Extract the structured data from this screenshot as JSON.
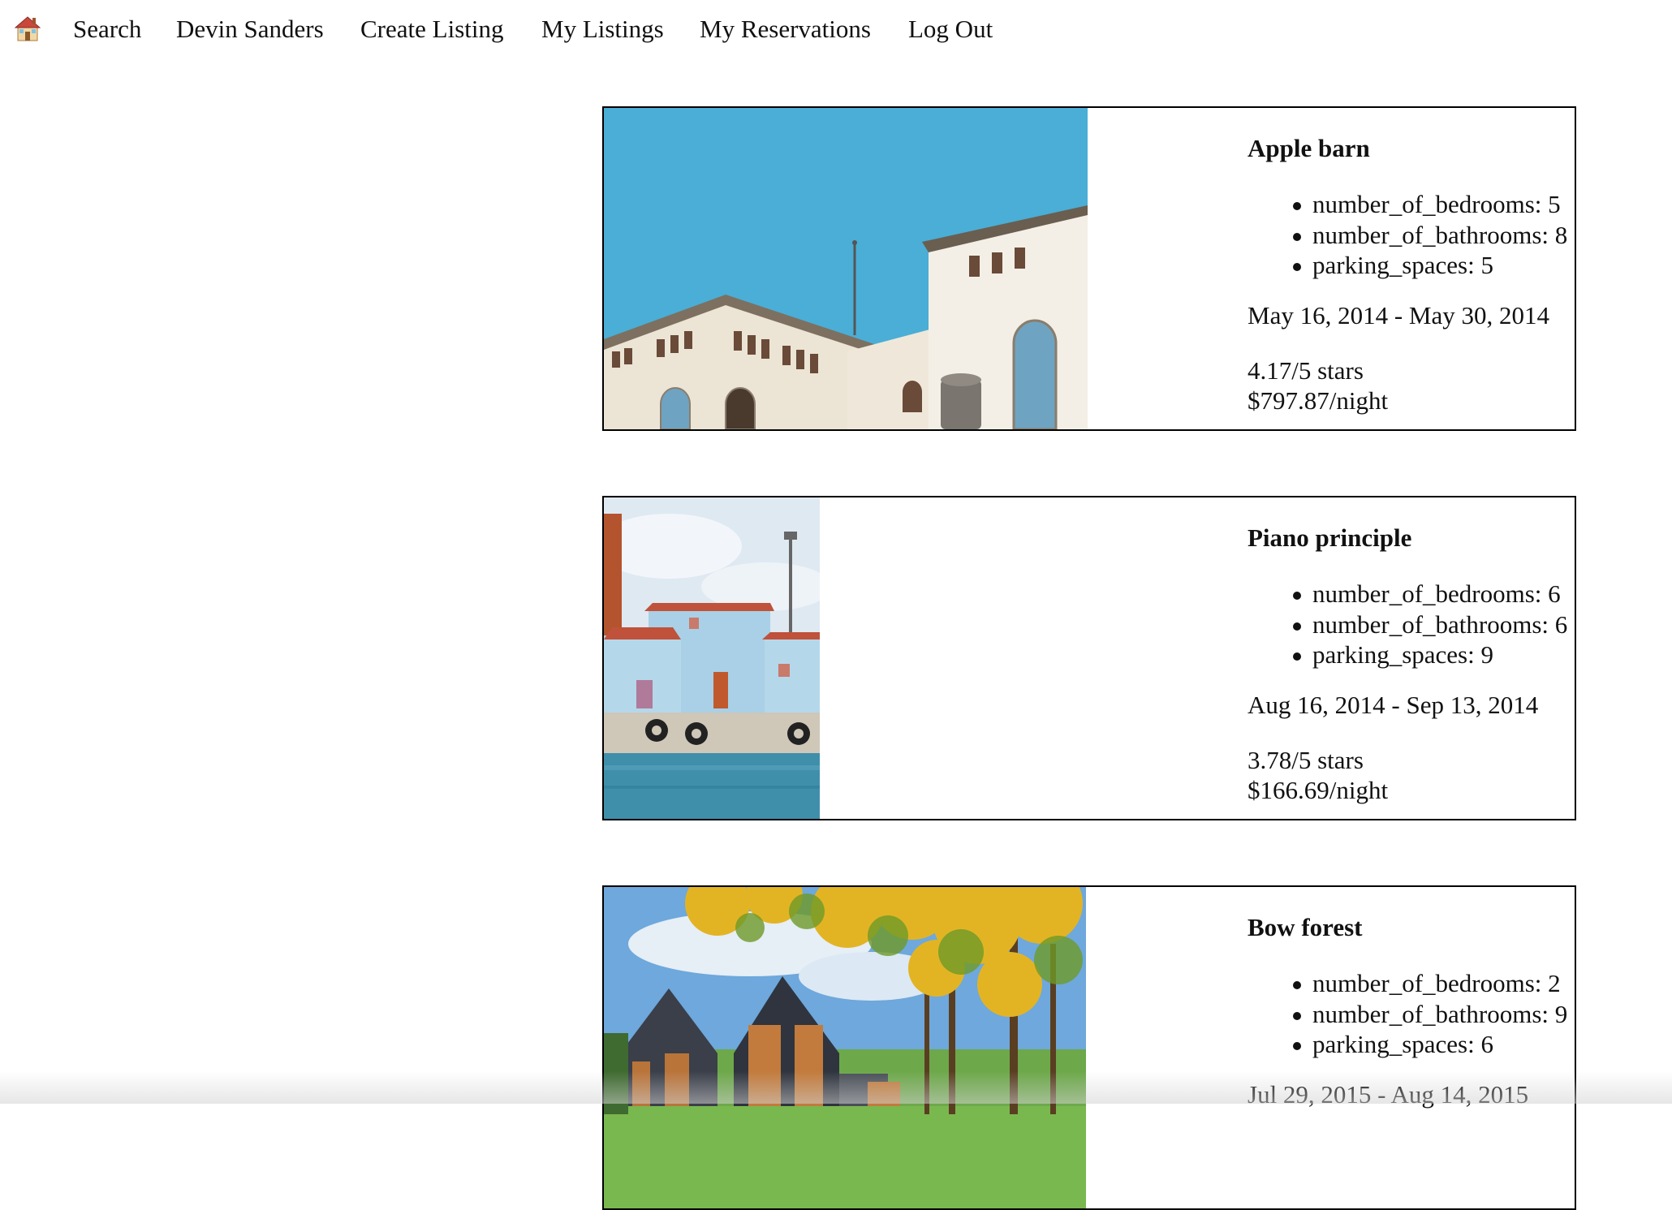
{
  "nav": {
    "home_icon": "house-emoji-icon",
    "items": [
      {
        "label": "Search"
      },
      {
        "label": "Devin Sanders"
      },
      {
        "label": "Create Listing"
      },
      {
        "label": "My Listings"
      },
      {
        "label": "My Reservations"
      },
      {
        "label": "Log Out"
      }
    ]
  },
  "listings": [
    {
      "title": "Apple barn",
      "features": [
        "number_of_bedrooms: 5",
        "number_of_bathrooms: 8",
        "parking_spaces: 5"
      ],
      "dates": "May 16, 2014 - May 30, 2014",
      "rating": "4.17/5 stars",
      "price": "$797.87/night"
    },
    {
      "title": "Piano principle",
      "features": [
        "number_of_bedrooms: 6",
        "number_of_bathrooms: 6",
        "parking_spaces: 9"
      ],
      "dates": "Aug 16, 2014 - Sep 13, 2014",
      "rating": "3.78/5 stars",
      "price": "$166.69/night"
    },
    {
      "title": "Bow forest",
      "features": [
        "number_of_bedrooms: 2",
        "number_of_bathrooms: 9",
        "parking_spaces: 6"
      ],
      "dates": "Jul 29, 2015 - Aug 14, 2015"
    }
  ]
}
